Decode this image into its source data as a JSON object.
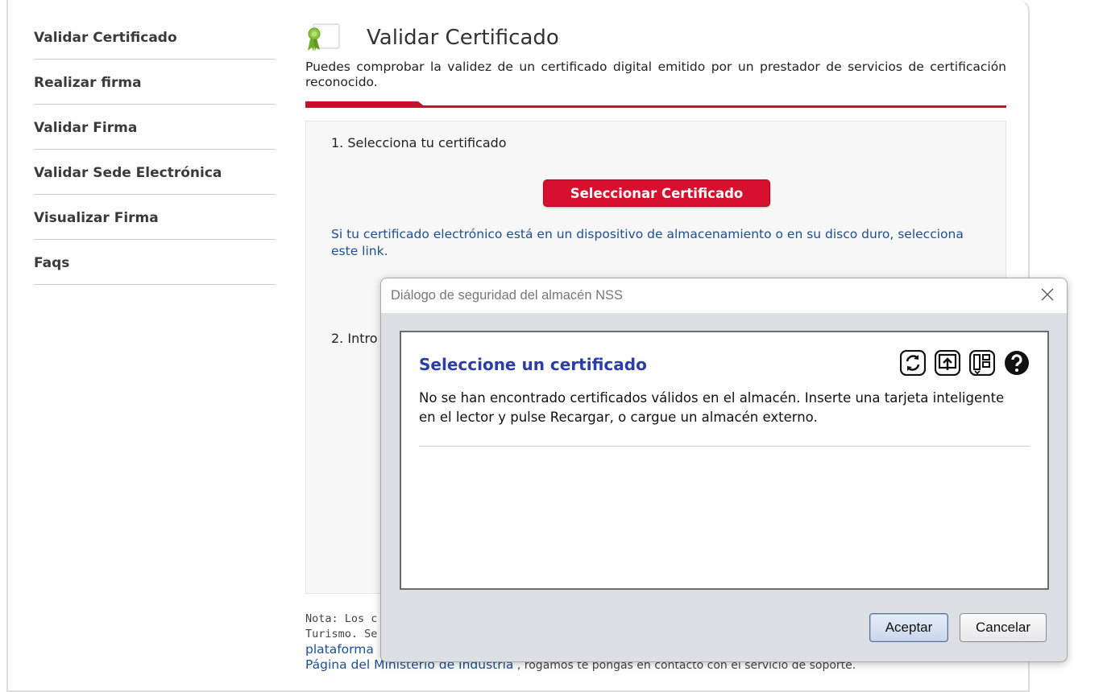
{
  "sidebar": {
    "items": [
      {
        "label": "Validar Certificado"
      },
      {
        "label": "Realizar firma"
      },
      {
        "label": "Validar Firma"
      },
      {
        "label": "Validar Sede Electrónica"
      },
      {
        "label": "Visualizar Firma"
      },
      {
        "label": "Faqs"
      }
    ]
  },
  "main": {
    "title": "Validar Certificado",
    "intro": "Puedes comprobar la validez de un certificado digital emitido por un prestador de servicios de certificación reconocido.",
    "step1": "1. Selecciona tu certificado",
    "select_button": "Seleccionar Certificado",
    "storage_link": "Si tu certificado electrónico está en un dispositivo de almacenamiento o en su disco duro, selecciona este link.",
    "step2_partial": "2. Intro"
  },
  "note": {
    "line1": "Nota: Los c",
    "line2": "Turismo. Se",
    "line3_link": "plataforma",
    "line4_link": "Página del Ministerio de Industria",
    "line4_text": ", rogamos te pongas en contacto con el servicio de soporte."
  },
  "dialog": {
    "window_title": "Diálogo de seguridad del almacén NSS",
    "heading": "Seleccione un certificado",
    "message": "No se han encontrado certificados válidos en el almacén. Inserte una tarjeta inteligente en el lector y pulse Recargar, o cargue un almacén externo.",
    "tools": [
      "reload-icon",
      "upload-store-icon",
      "view-toggle-icon",
      "help-icon"
    ],
    "ok_label": "Aceptar",
    "cancel_label": "Cancelar"
  },
  "colors": {
    "accent_red": "#c8102e",
    "link_blue": "#1d4f91",
    "dialog_heading_blue": "#2a3ea8"
  }
}
